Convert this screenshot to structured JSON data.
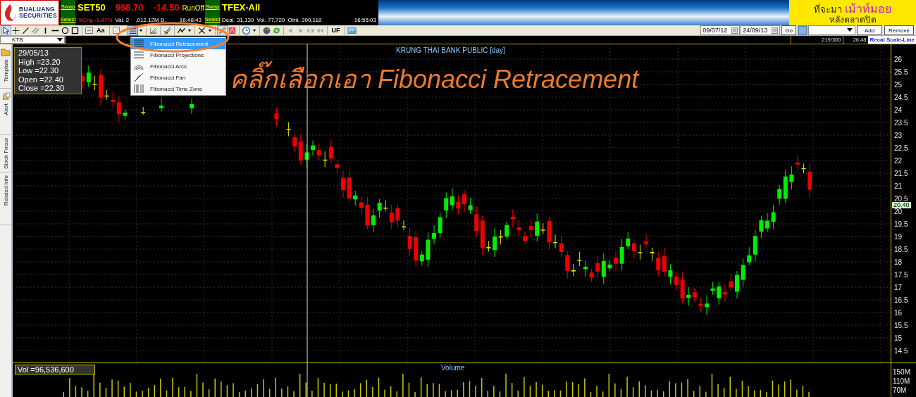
{
  "header": {
    "logo": {
      "line1": "BUALUANG",
      "line2": "SECURITIES"
    },
    "panels": [
      {
        "swap": "Swap",
        "select": "Select",
        "symbol": "SET50",
        "price": "968.70",
        "change": "-14.50",
        "session": "RunOff",
        "stats": [
          {
            "kind": "down",
            "text": "%Chg.-1.47%"
          },
          {
            "kind": "plain",
            "text": "Val. 2"
          },
          {
            "kind": "plain",
            "text": ",012.12M B."
          },
          {
            "kind": "time",
            "text": "16:48:43"
          }
        ]
      },
      {
        "swap": "Swap",
        "select": "Select",
        "symbol": "TFEX-All",
        "stats": [
          {
            "kind": "plain",
            "text": "Deal. 31,139"
          },
          {
            "kind": "plain",
            "text": "Vol. 77,729"
          },
          {
            "kind": "plain",
            "text": "OInt. 390,118"
          },
          {
            "kind": "time",
            "text": "16:55:03"
          }
        ]
      }
    ],
    "banner": {
      "line1_prefix": "ที่จะมา",
      "line1_highlight": "เม้าท์มอย",
      "line2": "หลังตลาดปิด"
    }
  },
  "toolbar": {
    "text_buttons": [
      "Aa",
      "UF"
    ],
    "from_date": "09/07/12",
    "to_date": "24/09/13",
    "go": "Go",
    "add": "Add",
    "remove": "Remove"
  },
  "fibonacci_menu": [
    {
      "label": "Fibonacci Retracement",
      "selected": true
    },
    {
      "label": "Fibonacci Projections",
      "selected": false
    },
    {
      "label": "Fibonacci Arcs",
      "selected": false
    },
    {
      "label": "Fibonacci Fan",
      "selected": false
    },
    {
      "label": "Fibonacci Time Zone",
      "selected": false
    }
  ],
  "symbol_bar": {
    "symbol": "KTB",
    "bars": "219/300",
    "scale_value": "26.48",
    "recal": "Recal Scale-Line"
  },
  "side_tabs": [
    {
      "label": "Template"
    },
    {
      "label": "Alert"
    },
    {
      "label": "Stock Focus"
    },
    {
      "label": "Related Info"
    }
  ],
  "chart": {
    "title": "KRUNG THAI BANK PUBLIC [day]",
    "ohlc": [
      "29/05/13",
      "High  =23.20",
      "Low  =22.30",
      "Open  =22.40",
      "Close  =22.30"
    ],
    "y_ticks": [
      "26",
      "25.5",
      "25",
      "24.5",
      "24",
      "23.5",
      "23",
      "22.5",
      "22",
      "21.5",
      "21",
      "20.5",
      "20",
      "19.5",
      "19",
      "18.5",
      "18",
      "17.5",
      "17",
      "16.5",
      "16",
      "15.5",
      "15",
      "14.5"
    ],
    "last_price": "20.40"
  },
  "volume": {
    "title": "Volume",
    "reading": "Vol  =96,536,600",
    "y_ticks": [
      "150M",
      "110M",
      "70M"
    ]
  },
  "annotation": {
    "text": "คลิ๊กเลือกเอา Fibonacci Retracement"
  }
}
